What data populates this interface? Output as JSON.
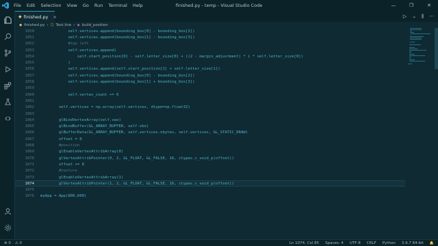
{
  "titlebar": {
    "menu": [
      "File",
      "Edit",
      "Selection",
      "View",
      "Go",
      "Run",
      "Terminal",
      "Help"
    ],
    "title": "finished.py - temp - Visual Studio Code",
    "controls": [
      "—",
      "❐",
      "✕"
    ]
  },
  "activity": {
    "icons": [
      "files-icon",
      "search-icon",
      "source-control-icon",
      "run-debug-icon",
      "extensions-icon",
      "test-icon",
      "remote-icon"
    ],
    "bottom_icons": [
      "account-icon",
      "settings-gear-icon"
    ]
  },
  "tab": {
    "label": "finished.py",
    "close": "×"
  },
  "tab_actions": [
    "▷",
    "⌄",
    "⫼",
    "···"
  ],
  "breadcrumb": [
    "finished.py",
    "Text.line",
    "build_position"
  ],
  "editor": {
    "lines": [
      {
        "n": "1050",
        "code": "            self.vertices.append(bounding_box[0] - bounding_box[2])",
        "cls": ""
      },
      {
        "n": "1051",
        "code": "            self.vertices.append(bounding_box[1] - bounding_box[3])",
        "cls": ""
      },
      {
        "n": "1052",
        "code": "            #top left",
        "cls": "kw-comment"
      },
      {
        "n": "1053",
        "code": "            self.vertices.append(",
        "cls": ""
      },
      {
        "n": "1054",
        "code": "                self.start_position[0] - self.letter_size[0] + ((2 - margin_adjustment) * i * self.letter_size[0])",
        "cls": ""
      },
      {
        "n": "1055",
        "code": "            )",
        "cls": ""
      },
      {
        "n": "1056",
        "code": "            self.vertices.append(self.start_position[1] + self.letter_size[1])",
        "cls": ""
      },
      {
        "n": "1057",
        "code": "            self.vertices.append(bounding_box[0] - bounding_box[2])",
        "cls": ""
      },
      {
        "n": "1058",
        "code": "            self.vertices.append(bounding_box[1] + bounding_box[3])",
        "cls": ""
      },
      {
        "n": "1059",
        "code": "",
        "cls": ""
      },
      {
        "n": "1060",
        "code": "            self.vertex_count += 6",
        "cls": ""
      },
      {
        "n": "1061",
        "code": "",
        "cls": ""
      },
      {
        "n": "1062",
        "code": "        self.vertices = np.array(self.vertices, dtype=np.float32)",
        "cls": ""
      },
      {
        "n": "1063",
        "code": "",
        "cls": ""
      },
      {
        "n": "1064",
        "code": "        glBindVertexArray(self.vao)",
        "cls": ""
      },
      {
        "n": "1065",
        "code": "        glBindBuffer(GL_ARRAY_BUFFER, self.vbo)",
        "cls": ""
      },
      {
        "n": "1066",
        "code": "        glBufferData(GL_ARRAY_BUFFER, self.vertices.nbytes, self.vertices, GL_STATIC_DRAW)",
        "cls": ""
      },
      {
        "n": "1067",
        "code": "        offset = 0",
        "cls": ""
      },
      {
        "n": "1068",
        "code": "        #position",
        "cls": "kw-comment"
      },
      {
        "n": "1069",
        "code": "        glEnableVertexAttribArray(0)",
        "cls": ""
      },
      {
        "n": "1070",
        "code": "        glVertexAttribPointer(0, 2, GL_FLOAT, GL_FALSE, 16, ctypes.c_void_p(offset))",
        "cls": ""
      },
      {
        "n": "1071",
        "code": "        offset += 8",
        "cls": ""
      },
      {
        "n": "1072",
        "code": "        #texture",
        "cls": "kw-comment"
      },
      {
        "n": "1073",
        "code": "        glEnableVertexAttribArray(1)",
        "cls": ""
      },
      {
        "n": "1074",
        "code": "        glVertexAttribPointer(1, 2, GL_FLOAT, GL_FALSE, 16, ctypes.c_void_p(offset))",
        "cls": "",
        "current": true
      },
      {
        "n": "1075",
        "code": "",
        "cls": ""
      },
      {
        "n": "1076",
        "code": "myApp = App(800,600)",
        "cls": ""
      }
    ]
  },
  "status": {
    "left": [
      "⊗ 0",
      "⚠ 0"
    ],
    "position": "Ln 1074, Col 85",
    "spaces": "Spaces: 4",
    "encoding": "UTF-8",
    "eol": "CRLF",
    "language": "Python",
    "interpreter": "3.9.7 64-bit",
    "bell": "🔔"
  },
  "colors": {
    "background": "#0f2a33",
    "code": "#4fb3c9",
    "accent": "#2e9bb5"
  }
}
